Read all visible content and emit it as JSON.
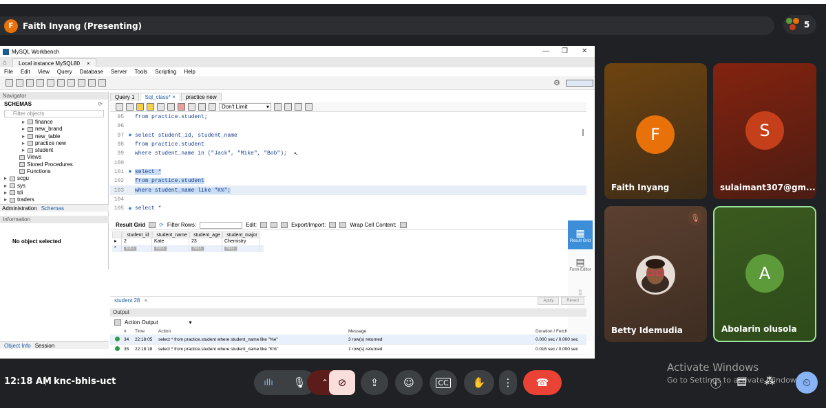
{
  "meet": {
    "presenter_initial": "F",
    "presenter_label": "Faith Inyang (Presenting)",
    "participants_count": "5",
    "time": "12:18 AM",
    "separator": "|",
    "meeting_code": "knc-bhis-uct",
    "tiles": [
      {
        "name": "Faith Inyang",
        "initial": "F",
        "avatar_color": "#e8710a"
      },
      {
        "name": "sulaimant307@gm...",
        "initial": "S",
        "avatar_color": "#c5401a"
      },
      {
        "name": "Betty Idemudia"
      },
      {
        "name": "Abolarin olusola",
        "initial": "A",
        "avatar_color": "#5d9a3a"
      }
    ],
    "windows_watermark": {
      "line1": "Activate Windows",
      "line2": "Go to Settings to activate Windows."
    }
  },
  "workbench": {
    "app_title": "MySQL Workbench",
    "connection_tab": "Local instance MySQL80",
    "menu": [
      "File",
      "Edit",
      "View",
      "Query",
      "Database",
      "Server",
      "Tools",
      "Scripting",
      "Help"
    ],
    "navigator_label": "Navigator",
    "schemas_label": "SCHEMAS",
    "filter_placeholder": "Filter objects",
    "tree": [
      {
        "label": "finance",
        "level": 2
      },
      {
        "label": "new_brand",
        "level": 2
      },
      {
        "label": "new_table",
        "level": 2
      },
      {
        "label": "practice new",
        "level": 2
      },
      {
        "label": "student",
        "level": 2
      },
      {
        "label": "Views",
        "level": 1
      },
      {
        "label": "Stored Procedures",
        "level": 1
      },
      {
        "label": "Functions",
        "level": 1
      },
      {
        "label": "scgu",
        "level": 0
      },
      {
        "label": "sys",
        "level": 0
      },
      {
        "label": "tdi",
        "level": 0
      },
      {
        "label": "traders",
        "level": 0
      }
    ],
    "nav_tabs": [
      "Administration",
      "Schemas"
    ],
    "information_label": "Information",
    "no_object": "No object selected",
    "info_tabs": [
      "Object Info",
      "Session"
    ],
    "query_tabs": [
      "Query 1",
      "Sql_class*",
      "practice new"
    ],
    "limit_value": "Don't Limit",
    "editor_lines": [
      {
        "num": "95",
        "code": "from practice.student;",
        "marker": ""
      },
      {
        "num": "96",
        "code": "",
        "marker": ""
      },
      {
        "num": "97",
        "code": "select student_id, student_name",
        "marker": "●"
      },
      {
        "num": "98",
        "code": "from practice.student",
        "marker": ""
      },
      {
        "num": "99",
        "code": "where student_name in (\"Jack\", \"Mike\", \"Bob\");",
        "marker": ""
      },
      {
        "num": "100",
        "code": "",
        "marker": ""
      },
      {
        "num": "101",
        "code": "select *",
        "marker": "●",
        "selected": true
      },
      {
        "num": "102",
        "code": "from practice.student",
        "marker": "",
        "selected": true
      },
      {
        "num": "103",
        "code": "where student_name like \"K%\";",
        "marker": "",
        "selected": true
      },
      {
        "num": "104",
        "code": "",
        "marker": ""
      },
      {
        "num": "105",
        "code": "select *",
        "marker": "●"
      }
    ],
    "result_toolbar": {
      "result_grid": "Result Grid",
      "filter_rows": "Filter Rows:",
      "edit": "Edit:",
      "export_import": "Export/Import:",
      "wrap": "Wrap Cell Content:"
    },
    "grid": {
      "columns": [
        "student_id",
        "student_name",
        "student_age",
        "student_major"
      ],
      "rows": [
        [
          "2",
          "Kate",
          "23",
          "Chemistry"
        ]
      ],
      "null_label": "NULL"
    },
    "side_panel": [
      "Result Grid",
      "Form Editor"
    ],
    "result_tab": "student 28",
    "apply_label": "Apply",
    "revert_label": "Revert",
    "output_label": "Output",
    "action_output": "Action Output",
    "output_headers": [
      "#",
      "Time",
      "Action",
      "Message",
      "Duration / Fetch"
    ],
    "output_rows": [
      {
        "n": "34",
        "time": "22:18:05",
        "action": "select * from practice.student where student_name like \"%e\"",
        "message": "3 row(s) returned",
        "duration": "0.000 sec / 0.000 sec"
      },
      {
        "n": "35",
        "time": "22:18:18",
        "action": "select * from practice.student where student_name like \"K%\"",
        "message": "1 row(s) returned",
        "duration": "0.016 sec / 0.000 sec"
      }
    ]
  }
}
